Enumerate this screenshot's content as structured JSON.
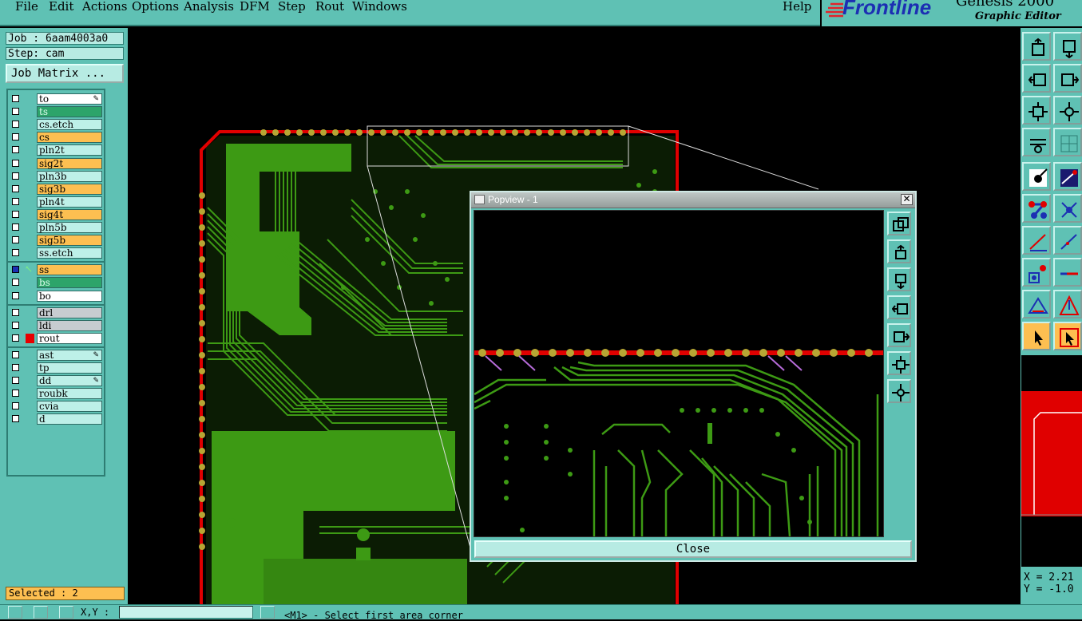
{
  "menu": [
    "File",
    "Edit",
    "Actions",
    "Options",
    "Analysis",
    "DFM",
    "Step",
    "Rout",
    "Windows"
  ],
  "help": "Help",
  "brand": {
    "logo": "Frontline",
    "product": "Genesis 2000",
    "subtitle": "Graphic Editor"
  },
  "job": {
    "job_label": "Job : 6aam4003a0",
    "step_label": "Step: cam",
    "matrix_button": "Job Matrix ..."
  },
  "layers": [
    {
      "name": "to",
      "color": "white",
      "mark": "pencil"
    },
    {
      "name": "ts",
      "color": "green"
    },
    {
      "name": "cs.etch",
      "color": "cyan"
    },
    {
      "name": "cs",
      "color": "orange"
    },
    {
      "name": "pln2t",
      "color": "cyan"
    },
    {
      "name": "sig2t",
      "color": "orange"
    },
    {
      "name": "pln3b",
      "color": "cyan"
    },
    {
      "name": "sig3b",
      "color": "orange"
    },
    {
      "name": "pln4t",
      "color": "cyan"
    },
    {
      "name": "sig4t",
      "color": "orange"
    },
    {
      "name": "pln5b",
      "color": "cyan"
    },
    {
      "name": "sig5b",
      "color": "orange"
    },
    {
      "name": "ss.etch",
      "color": "cyan"
    },
    {
      "name": "ss",
      "color": "orange",
      "active": true
    },
    {
      "name": "bs",
      "color": "green"
    },
    {
      "name": "bo",
      "color": "white"
    },
    {
      "name": "drl",
      "color": "gray"
    },
    {
      "name": "ldi",
      "color": "gray"
    },
    {
      "name": "rout",
      "color": "white",
      "red": true
    },
    {
      "name": "ast",
      "color": "cyan",
      "mark": "pencil"
    },
    {
      "name": "tp",
      "color": "cyan"
    },
    {
      "name": "dd",
      "color": "cyan",
      "mark": "pencil"
    },
    {
      "name": "roubk",
      "color": "cyan"
    },
    {
      "name": "cvia",
      "color": "cyan"
    },
    {
      "name": "d",
      "color": "cyan"
    }
  ],
  "selected": "Selected : 2",
  "coords": {
    "x": "X = 2.21",
    "y": "Y = -1.0"
  },
  "bottom": {
    "xy_label": "X,Y :",
    "xy_value": "",
    "prompt": "<M1> - Select first area corner"
  },
  "popview": {
    "title": "Popview - 1",
    "close_glyph": "✕",
    "close_button": "Close"
  },
  "colors": {
    "panel": "#5fc1b4",
    "copper": "#3d9a14",
    "outline": "#e00000",
    "pad": "#b7a634",
    "active": "#fdbf51"
  },
  "icons": {
    "toolbar": [
      "zoom-home-icon",
      "zoom-out-icon",
      "pan-left-icon",
      "pan-right-icon",
      "zoom-fit-icon",
      "zoom-area-icon",
      "measure-icon",
      "grid-icon",
      "select-point-icon",
      "feature-info-icon",
      "snap-node-icon",
      "snap-intersect-icon",
      "line-edit-icon",
      "line-draw-icon",
      "pad-add-icon",
      "line-add-icon",
      "triangle-select-icon",
      "triangle-move-icon",
      "pointer-icon",
      "pointer-box-icon"
    ],
    "popview": [
      "copy-view-icon",
      "zoom-in-icon",
      "zoom-out-icon",
      "pan-left-icon",
      "pan-right-icon",
      "zoom-fit-icon",
      "zoom-extent-icon"
    ]
  }
}
